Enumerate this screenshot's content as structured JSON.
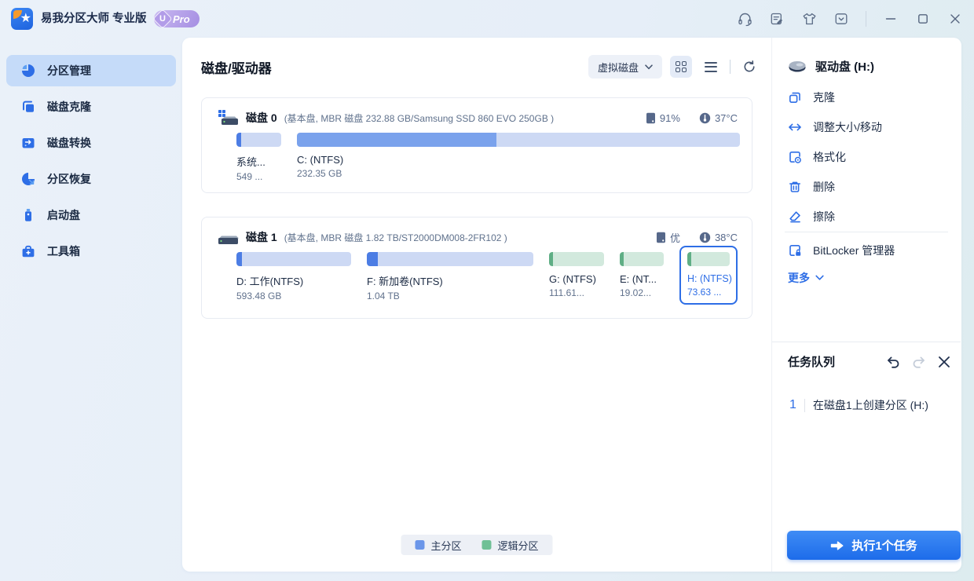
{
  "titlebar": {
    "app_title": "易我分区大师 专业版",
    "pro_u": "U",
    "pro_badge": "Pro"
  },
  "sidebar": {
    "items": [
      {
        "label": "分区管理",
        "selected": true
      },
      {
        "label": "磁盘克隆",
        "selected": false
      },
      {
        "label": "磁盘转换",
        "selected": false
      },
      {
        "label": "分区恢复",
        "selected": false
      },
      {
        "label": "启动盘",
        "selected": false
      },
      {
        "label": "工具箱",
        "selected": false
      }
    ]
  },
  "main": {
    "title": "磁盘/驱动器",
    "disk_filter": "虚拟磁盘",
    "disks": [
      {
        "name": "磁盘 0",
        "info": "(基本盘, MBR 磁盘 232.88 GB/Samsung SSD 860 EVO 250GB )",
        "health": "91%",
        "temp": "37°C",
        "partitions": [
          {
            "label": "系统...",
            "size": "549 ...",
            "type": "primary"
          },
          {
            "label": "C: (NTFS)",
            "size": "232.35 GB",
            "type": "primary"
          }
        ]
      },
      {
        "name": "磁盘 1",
        "info": "(基本盘, MBR 磁盘 1.82 TB/ST2000DM008-2FR102 )",
        "health": "优",
        "temp": "38°C",
        "partitions": [
          {
            "label": "D: 工作(NTFS)",
            "size": "593.48 GB",
            "type": "primary"
          },
          {
            "label": "F: 新加卷(NTFS)",
            "size": "1.04 TB",
            "type": "primary"
          },
          {
            "label": "G: (NTFS)",
            "size": "111.61...",
            "type": "logical"
          },
          {
            "label": "E: (NT...",
            "size": "19.02...",
            "type": "logical"
          },
          {
            "label": "H: (NTFS)",
            "size": "73.63 ...",
            "type": "logical",
            "selected": true
          }
        ]
      }
    ],
    "legend": [
      {
        "label": "主分区",
        "color": "#6b96e9"
      },
      {
        "label": "逻辑分区",
        "color": "#6fc096"
      }
    ]
  },
  "actions": {
    "header": "驱动盘 (H:)",
    "items": [
      "克隆",
      "调整大小/移动",
      "格式化",
      "删除",
      "擦除"
    ],
    "bitlocker": "BitLocker 管理器",
    "more": "更多"
  },
  "tasks": {
    "header": "任务队列",
    "items": [
      {
        "index": "1",
        "label": "在磁盘1上创建分区 (H:)"
      }
    ],
    "execute_label": "执行1个任务"
  },
  "colors": {
    "accent": "#2e6ee6",
    "primary_partition": "#6b96e9",
    "logical_partition": "#6fc096",
    "sidebar_selected": "#c5dbf9",
    "execute_button": "#2478f2"
  }
}
